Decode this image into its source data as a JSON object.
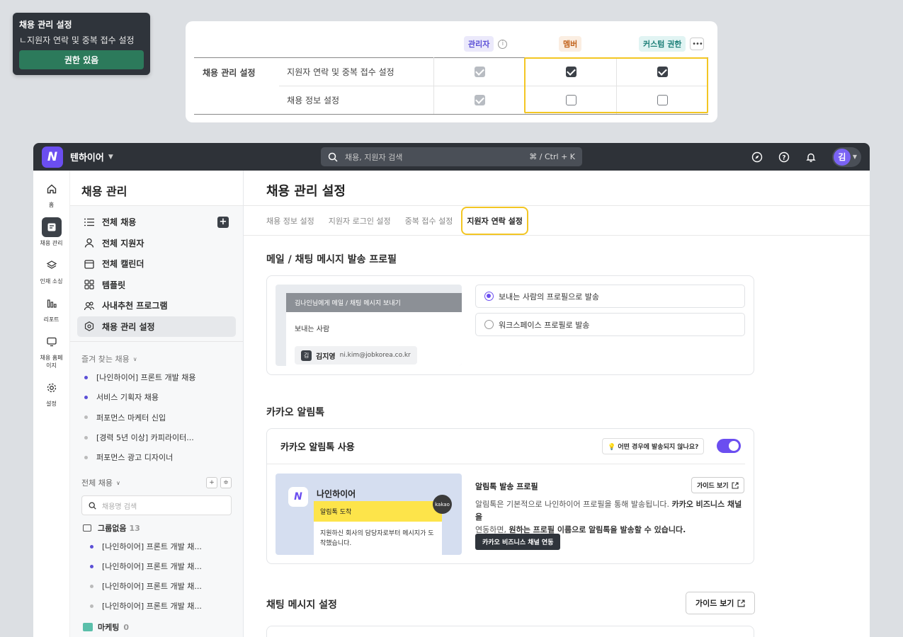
{
  "tooltip": {
    "title": "채용 관리 설정",
    "sub": "ㄴ지원자 연락 및 중복 접수 설정",
    "badge": "권한 있음"
  },
  "perm": {
    "headers": {
      "admin": "관리자",
      "member": "멤버",
      "custom": "커스텀 권한"
    },
    "group": "채용 관리 설정",
    "rows": [
      {
        "label": "지원자 연락 및 중복 접수 설정",
        "admin": true,
        "member": true,
        "custom": true
      },
      {
        "label": "채용 정보 설정",
        "admin": true,
        "member": false,
        "custom": false
      }
    ]
  },
  "topbar": {
    "workspace": "텐하이어",
    "search_placeholder": "채용, 지원자 검색",
    "shortcut": "⌘ / Ctrl + K",
    "avatar": "김"
  },
  "rail": [
    {
      "label": "홈",
      "icon": "home-icon"
    },
    {
      "label": "채용 관리",
      "icon": "recruit-icon"
    },
    {
      "label": "인재 소싱",
      "icon": "layers-icon"
    },
    {
      "label": "리포트",
      "icon": "chart-icon"
    },
    {
      "label": "채용 홈페이지",
      "icon": "monitor-icon"
    },
    {
      "label": "설정",
      "icon": "gear-icon"
    }
  ],
  "sidebar": {
    "title": "채용 관리",
    "nav": [
      "전체 채용",
      "전체 지원자",
      "전체 캘린더",
      "템플릿",
      "사내추천 프로그램",
      "채용 관리 설정"
    ],
    "fav_label": "즐겨 찾는 채용",
    "favs": [
      "[나인하이어] 프론트 개발 채용",
      "서비스 기획자 채용",
      "퍼포먼스 마케터 신입",
      "[경력 5년 이상] 카피라이터...",
      "퍼포먼스 광고 디자이너"
    ],
    "all_label": "전체 채용",
    "search_placeholder": "채용명 검색",
    "group": {
      "name": "그룹없음",
      "count": "13"
    },
    "group_items": [
      "[나인하이어] 프론트 개발 채...",
      "[나인하이어] 프론트 개발 채...",
      "[나인하이어] 프론트 개발 채...",
      "[나인하이어] 프론트 개발 채..."
    ],
    "marketing": {
      "name": "마케팅",
      "count": "0"
    }
  },
  "main": {
    "title": "채용 관리 설정",
    "tabs": [
      "채용 정보 설정",
      "지원자 로그인 설정",
      "중복 접수 설정",
      "지원자 연락 설정"
    ],
    "s1": {
      "title": "메일 / 채팅 메시지 발송 프로필",
      "preview_bar": "김나인님에게 메일 / 채팅 메시지 보내기",
      "sender_label": "보내는 사람",
      "sender_initial": "김",
      "sender_name": "김지영",
      "sender_email": "ni.kim@jobkorea.co.kr",
      "opt1": "보내는 사람의 프로필으로 발송",
      "opt2": "워크스페이스 프로필로 발송"
    },
    "s2": {
      "title": "카카오 알림톡",
      "use_label": "카카오 알림톡 사용",
      "question": "💡 어떤 경우에 발송되지 않나요?",
      "brand": "나인하이어",
      "kakao": "kakao",
      "msg_head": "알림톡 도착",
      "msg_body": "지원하신 회사의 담당자로부터 메시지가 도착했습니다.",
      "profile_title": "알림톡 발송 프로필",
      "guide": "가이드 보기",
      "desc_pre": "알림톡은 기본적으로 나인하이어 프로필을 통해 발송됩니다. ",
      "desc_bold1": "카카오 비즈니스 채널을",
      "desc_mid": "연동하면, ",
      "desc_bold2": "원하는 프로필 이름으로 알림톡을 발송할 수 있습니다.",
      "link_btn": "카카오 비즈니스 채널 연동"
    },
    "s3": {
      "title": "채팅 메시지 설정",
      "guide": "가이드 보기"
    }
  }
}
